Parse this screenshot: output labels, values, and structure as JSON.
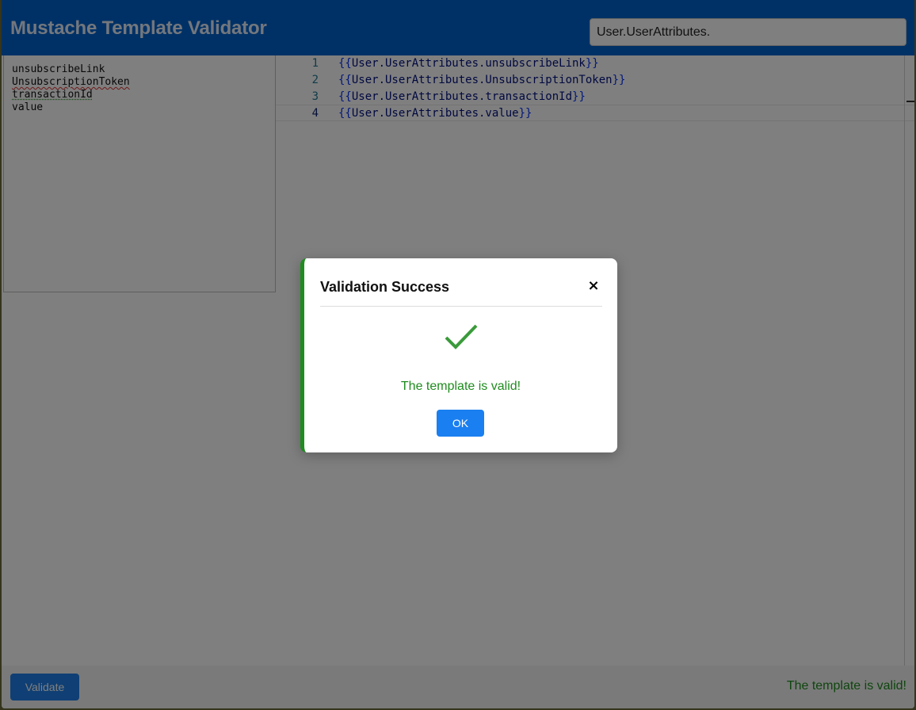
{
  "header": {
    "title": "Mustache Template Validator",
    "path_input_value": "User.UserAttributes."
  },
  "attributes": {
    "items": [
      "unsubscribeLink",
      "UnsubscriptionToken",
      "transactionId",
      "value"
    ]
  },
  "editor": {
    "lines": [
      {
        "number": "1",
        "open": "{{",
        "text": "User.UserAttributes.unsubscribeLink",
        "close": "}}"
      },
      {
        "number": "2",
        "open": "{{",
        "text": "User.UserAttributes.UnsubscriptionToken",
        "close": "}}"
      },
      {
        "number": "3",
        "open": "{{",
        "text": "User.UserAttributes.transactionId",
        "close": "}}"
      },
      {
        "number": "4",
        "open": "{{",
        "text": "User.UserAttributes.value",
        "close": "}}"
      }
    ],
    "active_line": "4"
  },
  "footer": {
    "validate_label": "Validate",
    "status": "The template is valid!"
  },
  "modal": {
    "title": "Validation Success",
    "close_glyph": "×",
    "icon": "checkmark-icon",
    "message": "The template is valid!",
    "ok_label": "OK",
    "accent_color": "#1f8c1f"
  },
  "colors": {
    "header": "#0062cc",
    "primary_button": "#1a7ff0",
    "success": "#1f8c1f"
  }
}
